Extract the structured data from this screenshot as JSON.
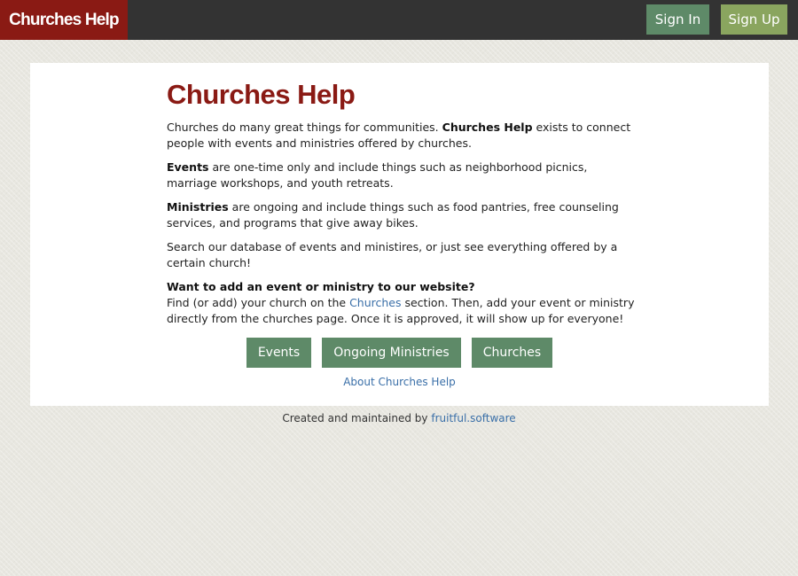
{
  "header": {
    "brand": "Churches Help",
    "sign_in": "Sign In",
    "sign_up": "Sign Up"
  },
  "main": {
    "title": "Churches Help",
    "intro_start": "Churches do many great things for communities. ",
    "intro_bold": "Churches Help",
    "intro_end": " exists to connect people with events and ministries offered by churches.",
    "events_bold": "Events",
    "events_text": " are one-time only and include things such as neighborhood picnics, marriage workshops, and youth retreats.",
    "ministries_bold": "Ministries",
    "ministries_text": " are ongoing and include things such as food pantries, free counseling services, and programs that give away bikes.",
    "search_text": "Search our database of events and ministires, or just see everything offered by a certain church!",
    "add_heading": "Want to add an event or ministry to our website?",
    "add_text_start": "Find (or add) your church on the ",
    "add_link": "Churches",
    "add_text_end": " section. Then, add your event or ministry directly from the churches page. Once it is approved, it will show up for everyone!",
    "buttons": {
      "events": "Events",
      "ministries": "Ongoing Ministries",
      "churches": "Churches"
    },
    "about_link": "About Churches Help"
  },
  "footer": {
    "text": "Created and maintained by ",
    "link": "fruitful.software"
  },
  "colors": {
    "brand": "#8a1a14",
    "topbar": "#333333",
    "button_green": "#5e8a68",
    "signup_green": "#8aa55f",
    "link_blue": "#3a6fa8"
  }
}
